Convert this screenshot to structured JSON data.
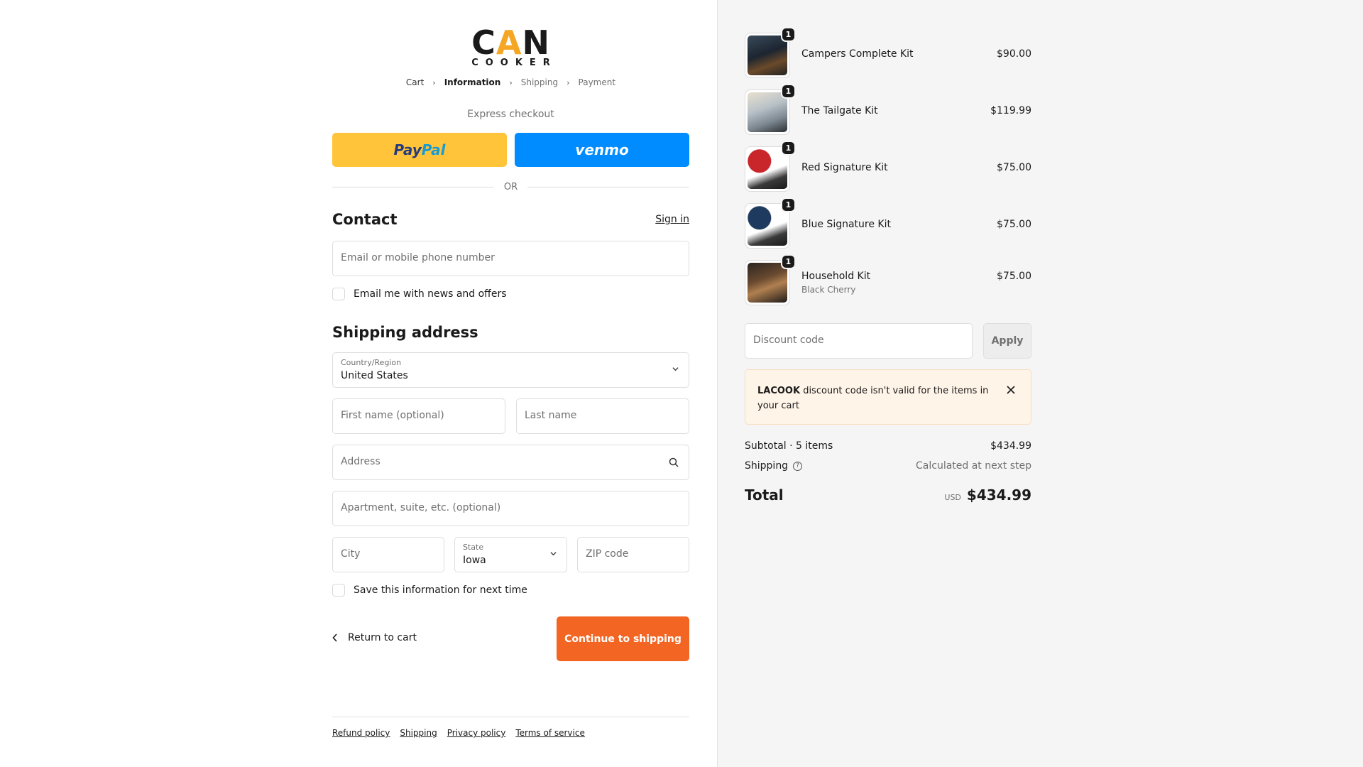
{
  "brand": {
    "logo_main": "CAN",
    "logo_sub": "COOKER",
    "accent_color": "#f5a623"
  },
  "breadcrumb": [
    "Cart",
    "Information",
    "Shipping",
    "Payment"
  ],
  "express": {
    "title": "Express checkout",
    "paypal_label_1": "Pay",
    "paypal_label_2": "Pal",
    "venmo_label": "venmo"
  },
  "divider_text": "OR",
  "contact": {
    "heading": "Contact",
    "sign_in": "Sign in",
    "email_placeholder": "Email or mobile phone number",
    "newsletter_label": "Email me with news and offers"
  },
  "shipping": {
    "heading": "Shipping address",
    "country_label": "Country/Region",
    "country_value": "United States",
    "first_name_placeholder": "First name (optional)",
    "last_name_placeholder": "Last name",
    "address_placeholder": "Address",
    "apartment_placeholder": "Apartment, suite, etc. (optional)",
    "city_placeholder": "City",
    "state_label": "State",
    "state_value": "Iowa",
    "zip_placeholder": "ZIP code",
    "save_label": "Save this information for next time"
  },
  "actions": {
    "return_label": "Return to cart",
    "continue_label": "Continue to shipping",
    "continue_color": "#f26522"
  },
  "footer": [
    "Refund policy",
    "Shipping",
    "Privacy policy",
    "Terms of service"
  ],
  "cart": {
    "items": [
      {
        "name": "Campers Complete Kit",
        "price": "$90.00",
        "qty": "1",
        "variant": ""
      },
      {
        "name": "The Tailgate Kit",
        "price": "$119.99",
        "qty": "1",
        "variant": ""
      },
      {
        "name": "Red Signature Kit",
        "price": "$75.00",
        "qty": "1",
        "variant": ""
      },
      {
        "name": "Blue Signature Kit",
        "price": "$75.00",
        "qty": "1",
        "variant": ""
      },
      {
        "name": "Household Kit",
        "price": "$75.00",
        "qty": "1",
        "variant": "Black Cherry"
      }
    ],
    "discount_placeholder": "Discount code",
    "apply_label": "Apply",
    "alert_code": "LACOOK",
    "alert_text": " discount code isn't valid for the items in your cart",
    "subtotal_label": "Subtotal · 5 items",
    "subtotal_value": "$434.99",
    "shipping_label": "Shipping",
    "shipping_value": "Calculated at next step",
    "total_label": "Total",
    "total_currency": "USD",
    "total_value": "$434.99"
  }
}
